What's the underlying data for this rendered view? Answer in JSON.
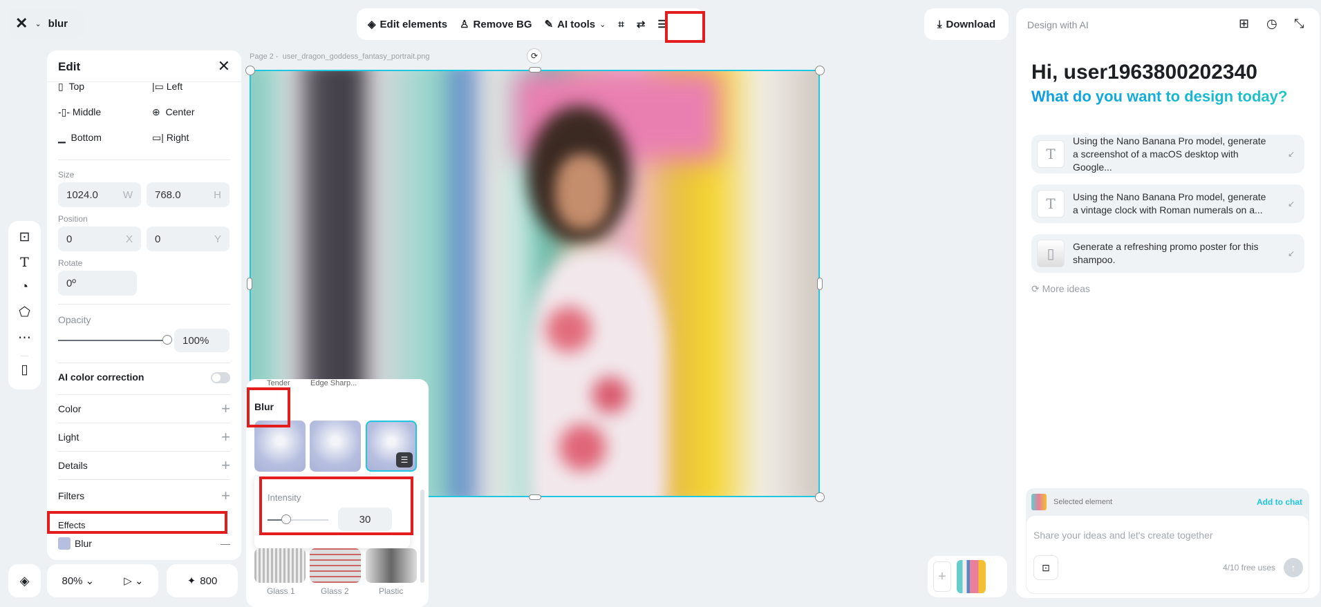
{
  "header": {
    "project_name": "blur",
    "download": "Download"
  },
  "toolbar": {
    "edit_elements": "Edit elements",
    "remove_bg": "Remove BG",
    "ai_tools": "AI tools"
  },
  "canvas": {
    "page_label": "Page 2 -",
    "file_name": "user_dragon_goddess_fantasy_portrait.png"
  },
  "edit_panel": {
    "title": "Edit",
    "align": [
      {
        "label": "Top"
      },
      {
        "label": "Left"
      },
      {
        "label": "Middle"
      },
      {
        "label": "Center"
      },
      {
        "label": "Bottom"
      },
      {
        "label": "Right"
      }
    ],
    "size_label": "Size",
    "width": "1024.0",
    "width_unit": "W",
    "height": "768.0",
    "height_unit": "H",
    "position_label": "Position",
    "x": "0",
    "x_unit": "X",
    "y": "0",
    "y_unit": "Y",
    "rotate_label": "Rotate",
    "rotate": "0º",
    "opacity_label": "Opacity",
    "opacity": "100%",
    "opacity_value": 100,
    "ai_color": "AI color correction",
    "ai_color_on": false,
    "sections": [
      {
        "label": "Color"
      },
      {
        "label": "Light"
      },
      {
        "label": "Details"
      },
      {
        "label": "Filters"
      }
    ],
    "effects_label": "Effects",
    "effect_applied": "Blur"
  },
  "effects_popover": {
    "prev_row": [
      "Tender",
      "Edge Sharp..."
    ],
    "section": "Blur",
    "intensity_label": "Intensity",
    "intensity": "30",
    "intensity_value": 30,
    "next_row": [
      "Glass 1",
      "Glass 2",
      "Plastic"
    ]
  },
  "bottom": {
    "zoom": "80%",
    "credits": "800"
  },
  "ai_panel": {
    "title": "Design with AI",
    "greeting": "Hi, user1963800202340",
    "subtitle": "What do you want to design today?",
    "suggestions": [
      {
        "text": "Using the Nano Banana Pro model, generate a screenshot of a macOS desktop with Google..."
      },
      {
        "text": "Using the Nano Banana Pro model, generate a vintage clock with Roman numerals on a..."
      },
      {
        "text": "Generate a refreshing promo poster for this shampoo."
      }
    ],
    "more_ideas": "More ideas",
    "selected_element": "Selected element",
    "add_to_chat": "Add to chat",
    "input_placeholder": "Share your ideas and let's create together",
    "free_uses": "4/10 free uses"
  },
  "colors": {
    "accent": "#1fc6e0",
    "highlight": "#e31d1d"
  }
}
